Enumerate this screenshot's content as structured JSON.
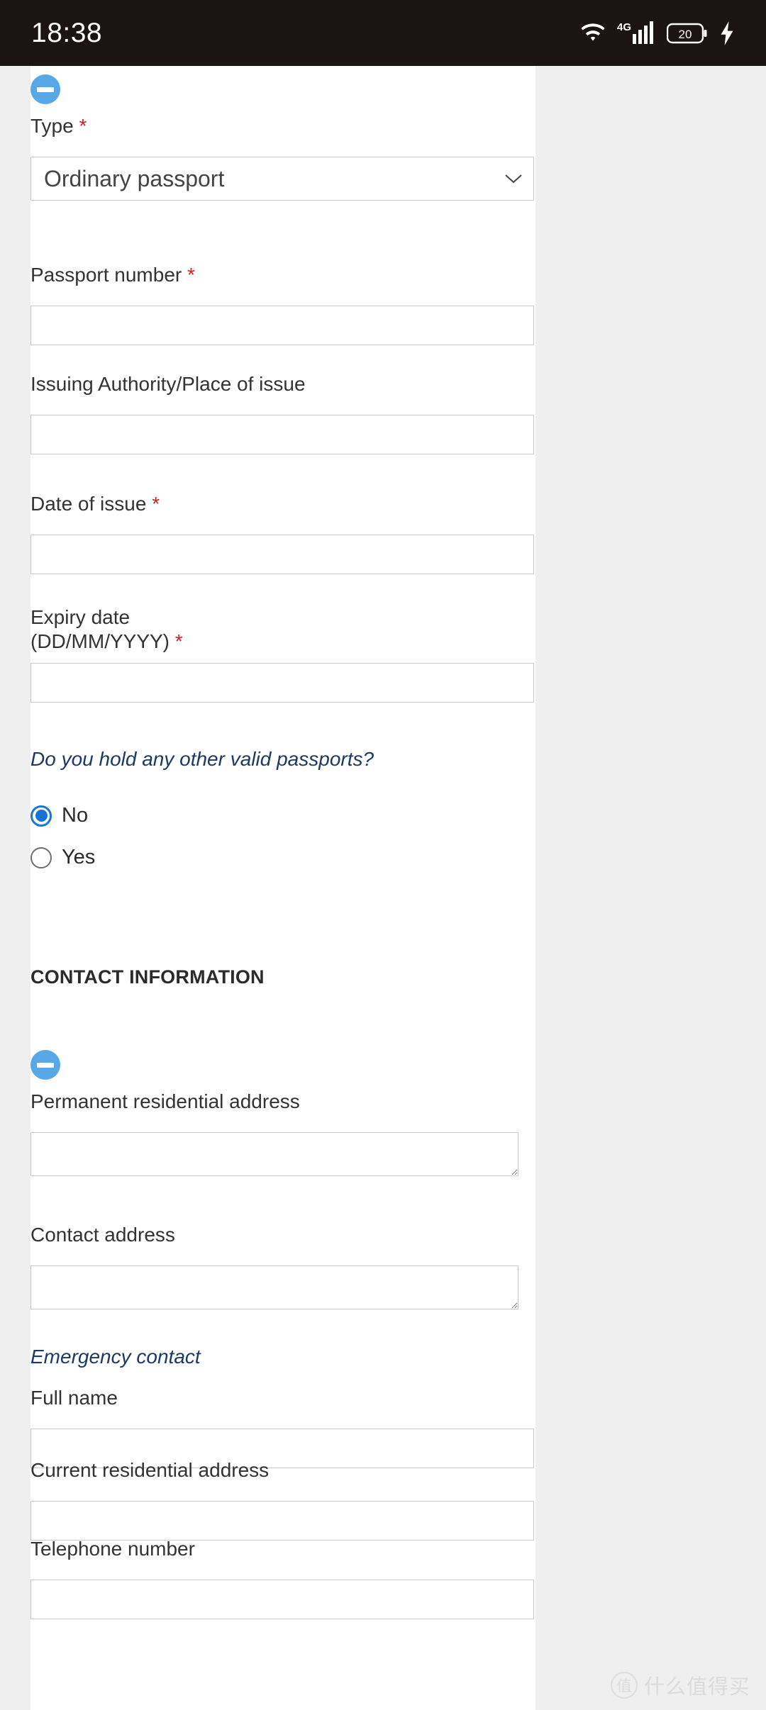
{
  "status_bar": {
    "time": "18:38",
    "wifi_icon": "wifi-icon",
    "network_label": "4G",
    "signal_icon": "signal-bars-icon",
    "battery_level": "20",
    "charging_icon": "lightning-bolt-icon"
  },
  "passport_section": {
    "collapse_icon": "minus-circle-icon",
    "type": {
      "label": "Type",
      "required_mark": "*",
      "selected_value": "Ordinary passport",
      "chevron_icon": "chevron-down-icon",
      "options": [
        "Ordinary passport"
      ]
    },
    "passport_number": {
      "label": "Passport number",
      "required_mark": "*",
      "value": ""
    },
    "issuing_authority": {
      "label": "Issuing Authority/Place of issue",
      "value": ""
    },
    "date_of_issue": {
      "label": "Date of issue",
      "required_mark": "*",
      "value": ""
    },
    "expiry_date": {
      "label_line1": "Expiry date",
      "label_line2": "(DD/MM/YYYY)",
      "required_mark": "*",
      "value": ""
    },
    "other_passports": {
      "question": "Do you hold any other valid passports?",
      "options": [
        {
          "label": "No",
          "selected": true
        },
        {
          "label": "Yes",
          "selected": false
        }
      ]
    }
  },
  "contact_section": {
    "heading": "CONTACT INFORMATION",
    "collapse_icon": "minus-circle-icon",
    "permanent_address": {
      "label": "Permanent residential address",
      "value": ""
    },
    "contact_address": {
      "label": "Contact address",
      "value": ""
    },
    "emergency_contact": {
      "heading": "Emergency contact",
      "full_name": {
        "label": "Full name",
        "value": ""
      },
      "current_address": {
        "label": "Current residential address",
        "value": ""
      },
      "telephone": {
        "label": "Telephone number",
        "value": ""
      }
    }
  },
  "watermark": {
    "mark": "值",
    "text": "什么值得买"
  },
  "colors": {
    "accent_blue": "#58a8e8",
    "radio_blue": "#1673d4",
    "required_red": "#cc2222",
    "italic_navy": "#1f3864",
    "page_bg": "#efefef",
    "sheet_bg": "#ffffff",
    "statusbar_bg": "#1c1412"
  }
}
